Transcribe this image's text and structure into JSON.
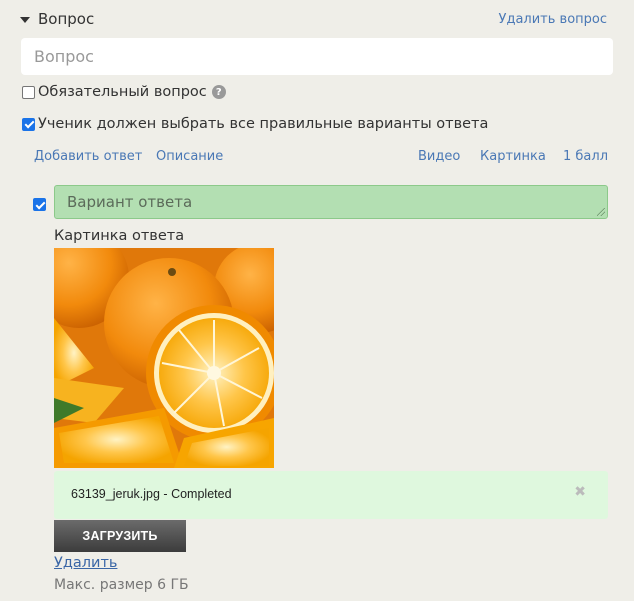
{
  "question": {
    "header_label": "Вопрос",
    "delete_label": "Удалить вопрос",
    "input_placeholder": "Вопрос"
  },
  "options": {
    "required_label": "Обязательный вопрос",
    "required_checked": false,
    "all_correct_label": "Ученик должен выбрать все правильные варианты ответа",
    "all_correct_checked": true
  },
  "toolbar": {
    "add_answer": "Добавить ответ",
    "description": "Описание",
    "video": "Видео",
    "picture": "Картинка",
    "points": "1 балл"
  },
  "answer": {
    "checked": true,
    "text": "Вариант ответа",
    "picture_label": "Картинка ответа"
  },
  "upload": {
    "file_status": "63139_jeruk.jpg - Completed",
    "upload_button": "ЗАГРУЗИТЬ",
    "delete_link": "Удалить",
    "max_size": "Макс. размер 6 ГБ"
  },
  "colors": {
    "background": "#efeee8",
    "link": "#4a78b5",
    "answer_bg": "#b3dfb2",
    "upload_bg": "#dff8de"
  }
}
